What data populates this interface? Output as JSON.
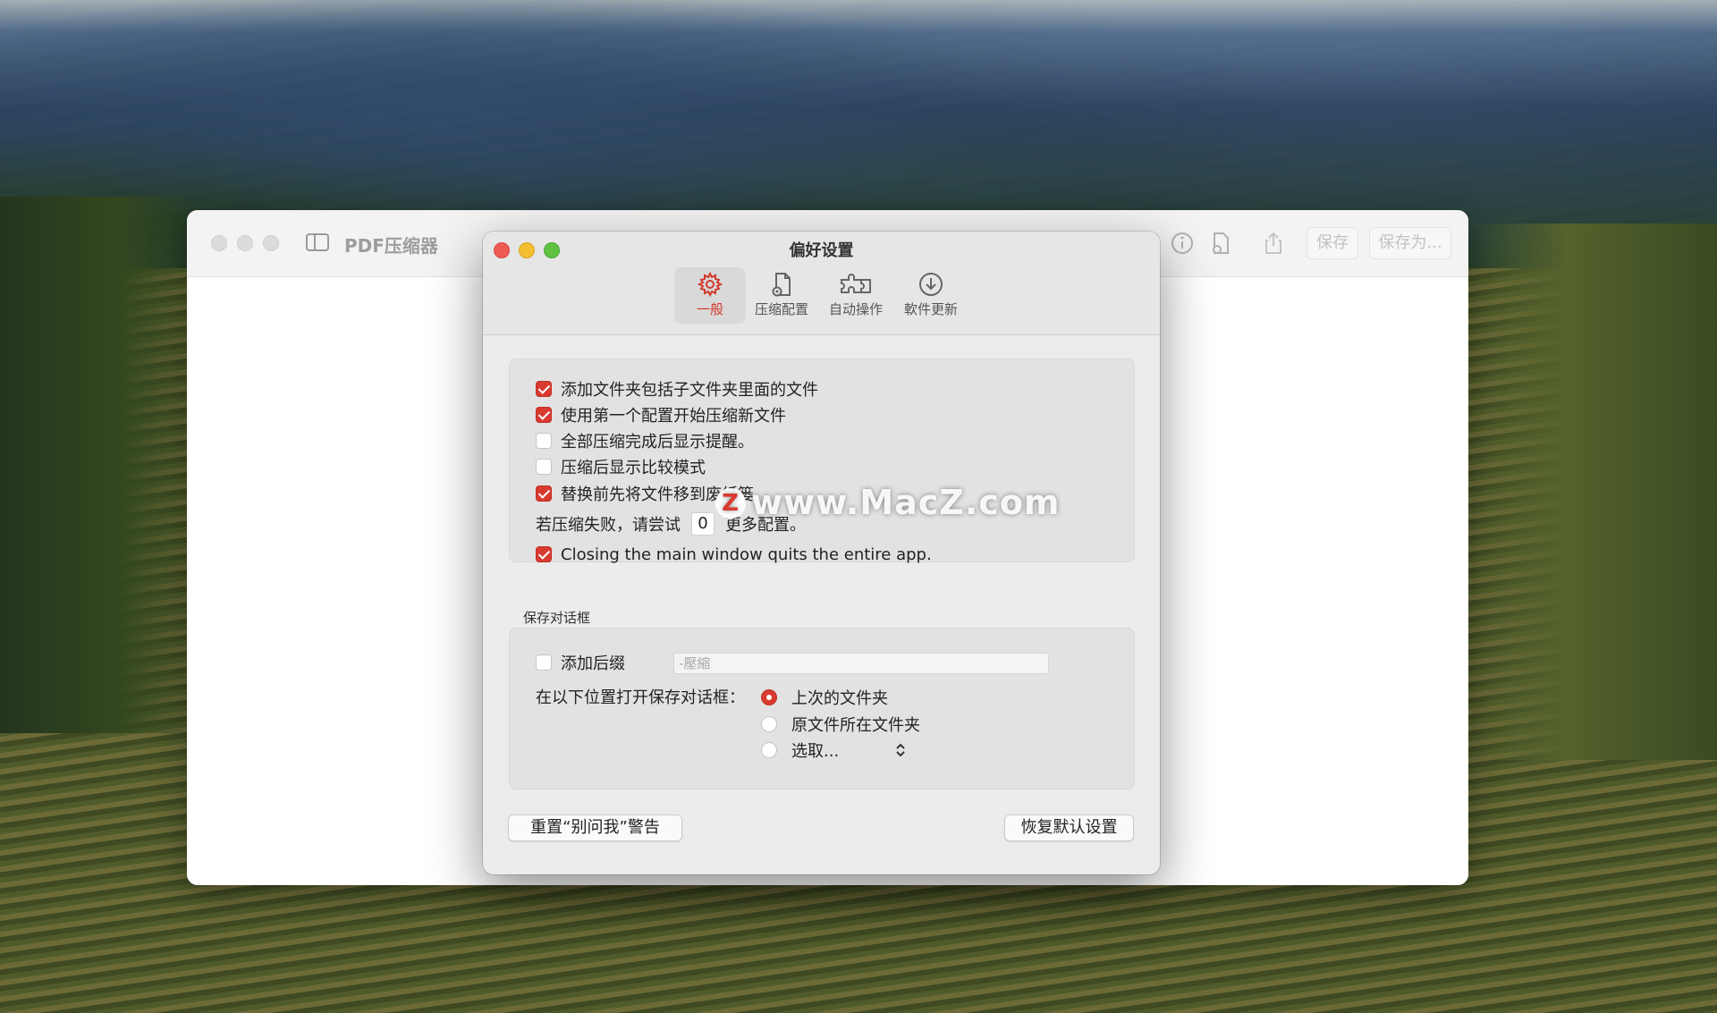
{
  "main_window": {
    "title": "PDF压缩器",
    "toolbar": {
      "save_label": "保存",
      "save_as_label": "保存为..."
    }
  },
  "prefs": {
    "title": "偏好设置",
    "tabs": [
      {
        "label": "一般",
        "icon": "gear-icon",
        "active": true
      },
      {
        "label": "压缩配置",
        "icon": "doc-gear-icon",
        "active": false
      },
      {
        "label": "自动操作",
        "icon": "puzzle-icon",
        "active": false
      },
      {
        "label": "軟件更新",
        "icon": "download-circle-icon",
        "active": false
      }
    ],
    "general": {
      "options": [
        {
          "label": "添加文件夹包括子文件夹里面的文件",
          "checked": true
        },
        {
          "label": "使用第一个配置开始压缩新文件",
          "checked": true
        },
        {
          "label": "全部压缩完成后显示提醒。",
          "checked": false
        },
        {
          "label": "压缩后显示比较模式",
          "checked": false
        },
        {
          "label": "替换前先将文件移到废纸篓",
          "checked": true
        }
      ],
      "retry_prefix": "若压缩失败，请尝试",
      "retry_value": "0",
      "retry_suffix": "更多配置。",
      "quit_option": {
        "label": "Closing the main window quits the entire app.",
        "checked": true
      }
    },
    "save_dialog": {
      "section_label": "保存对话框",
      "suffix_label": "添加后缀",
      "suffix_checked": false,
      "suffix_placeholder": "-壓縮",
      "location_label": "在以下位置打开保存对话框：",
      "location_options": [
        {
          "label": "上次的文件夹",
          "selected": true
        },
        {
          "label": "原文件所在文件夹",
          "selected": false
        },
        {
          "label": "选取...",
          "selected": false
        }
      ]
    },
    "buttons": {
      "reset_warnings": "重置“别问我”警告",
      "restore_defaults": "恢复默认设置"
    }
  },
  "watermark": {
    "logo_letter": "Z",
    "text": "www.MacZ.com"
  },
  "colors": {
    "accent": "#d93a2f",
    "close": "#ee5b53",
    "minimize": "#f5bd30",
    "zoom": "#5fc240"
  }
}
